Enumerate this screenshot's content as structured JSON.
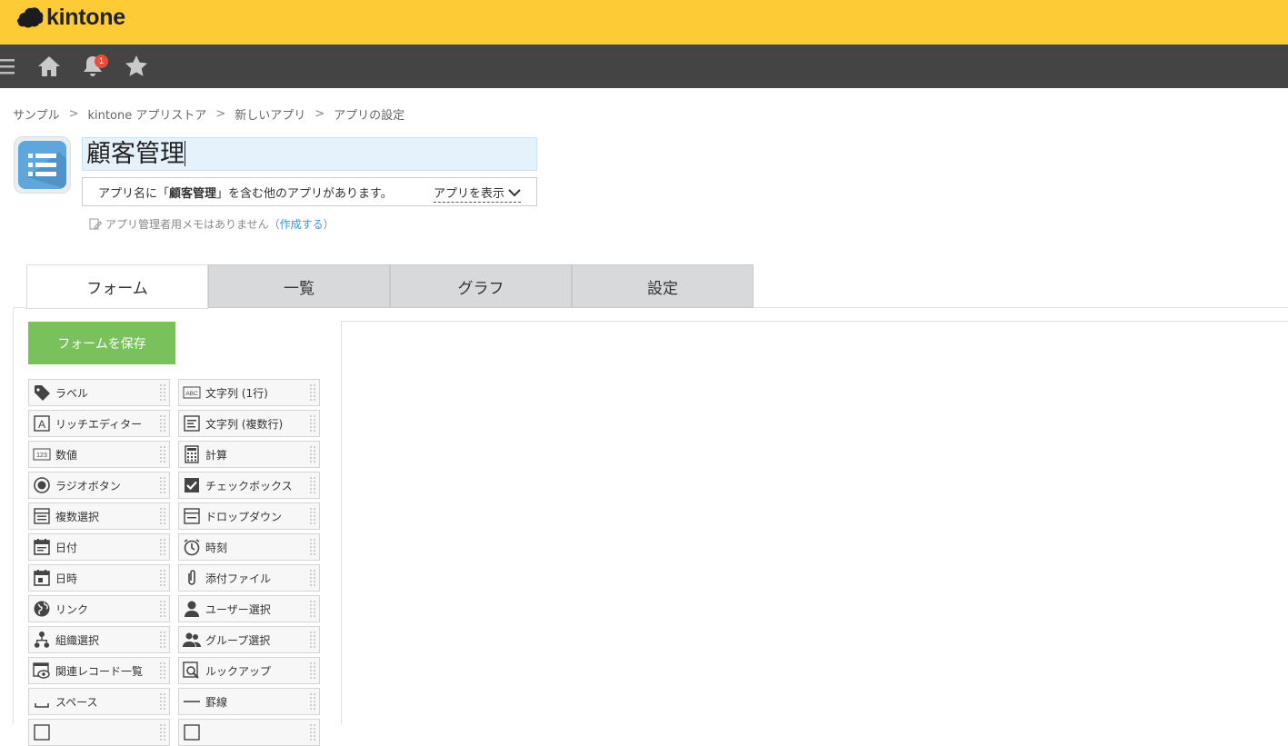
{
  "brand": {
    "name": "kintone",
    "bar_color": "#fdcb35",
    "toolbar_color": "#444444"
  },
  "toolbar": {
    "icons": [
      "menu-icon",
      "home-icon",
      "bell-icon",
      "star-icon"
    ],
    "notification_count": "1"
  },
  "breadcrumb": {
    "items": [
      "サンプル",
      "kintone アプリストア",
      "新しいアプリ",
      "アプリの設定"
    ],
    "separator": ">"
  },
  "app": {
    "name": "顧客管理",
    "dup_prefix": "アプリ名に「",
    "dup_name": "顧客管理",
    "dup_suffix": "」を含む他のアプリがあります。",
    "show_apps_label": "アプリを表示",
    "memo_text": "アプリ管理者用メモはありません（",
    "memo_link": "作成する",
    "memo_close": "）"
  },
  "tabs": [
    {
      "label": "フォーム",
      "active": true
    },
    {
      "label": "一覧",
      "active": false
    },
    {
      "label": "グラフ",
      "active": false
    },
    {
      "label": "設定",
      "active": false
    }
  ],
  "form": {
    "save_label": "フォームを保存",
    "save_color": "#79c25b"
  },
  "palette": [
    {
      "label": "ラベル",
      "icon": "tag-icon"
    },
    {
      "label": "文字列 (1行)",
      "icon": "abc-icon"
    },
    {
      "label": "リッチエディター",
      "icon": "rich-text-icon"
    },
    {
      "label": "文字列 (複数行)",
      "icon": "multiline-icon"
    },
    {
      "label": "数値",
      "icon": "number-icon"
    },
    {
      "label": "計算",
      "icon": "calculator-icon"
    },
    {
      "label": "ラジオボタン",
      "icon": "radio-icon"
    },
    {
      "label": "チェックボックス",
      "icon": "checkbox-icon"
    },
    {
      "label": "複数選択",
      "icon": "multi-select-icon"
    },
    {
      "label": "ドロップダウン",
      "icon": "dropdown-icon"
    },
    {
      "label": "日付",
      "icon": "calendar-icon"
    },
    {
      "label": "時刻",
      "icon": "clock-icon"
    },
    {
      "label": "日時",
      "icon": "calendar-time-icon"
    },
    {
      "label": "添付ファイル",
      "icon": "paperclip-icon"
    },
    {
      "label": "リンク",
      "icon": "globe-icon"
    },
    {
      "label": "ユーザー選択",
      "icon": "user-icon"
    },
    {
      "label": "組織選択",
      "icon": "org-icon"
    },
    {
      "label": "グループ選択",
      "icon": "group-icon"
    },
    {
      "label": "関連レコード一覧",
      "icon": "related-records-icon"
    },
    {
      "label": "ルックアップ",
      "icon": "lookup-icon"
    },
    {
      "label": "スペース",
      "icon": "space-icon"
    },
    {
      "label": "罫線",
      "icon": "line-icon"
    },
    {
      "label": "",
      "icon": "more-icon"
    },
    {
      "label": "",
      "icon": "more-icon"
    }
  ]
}
